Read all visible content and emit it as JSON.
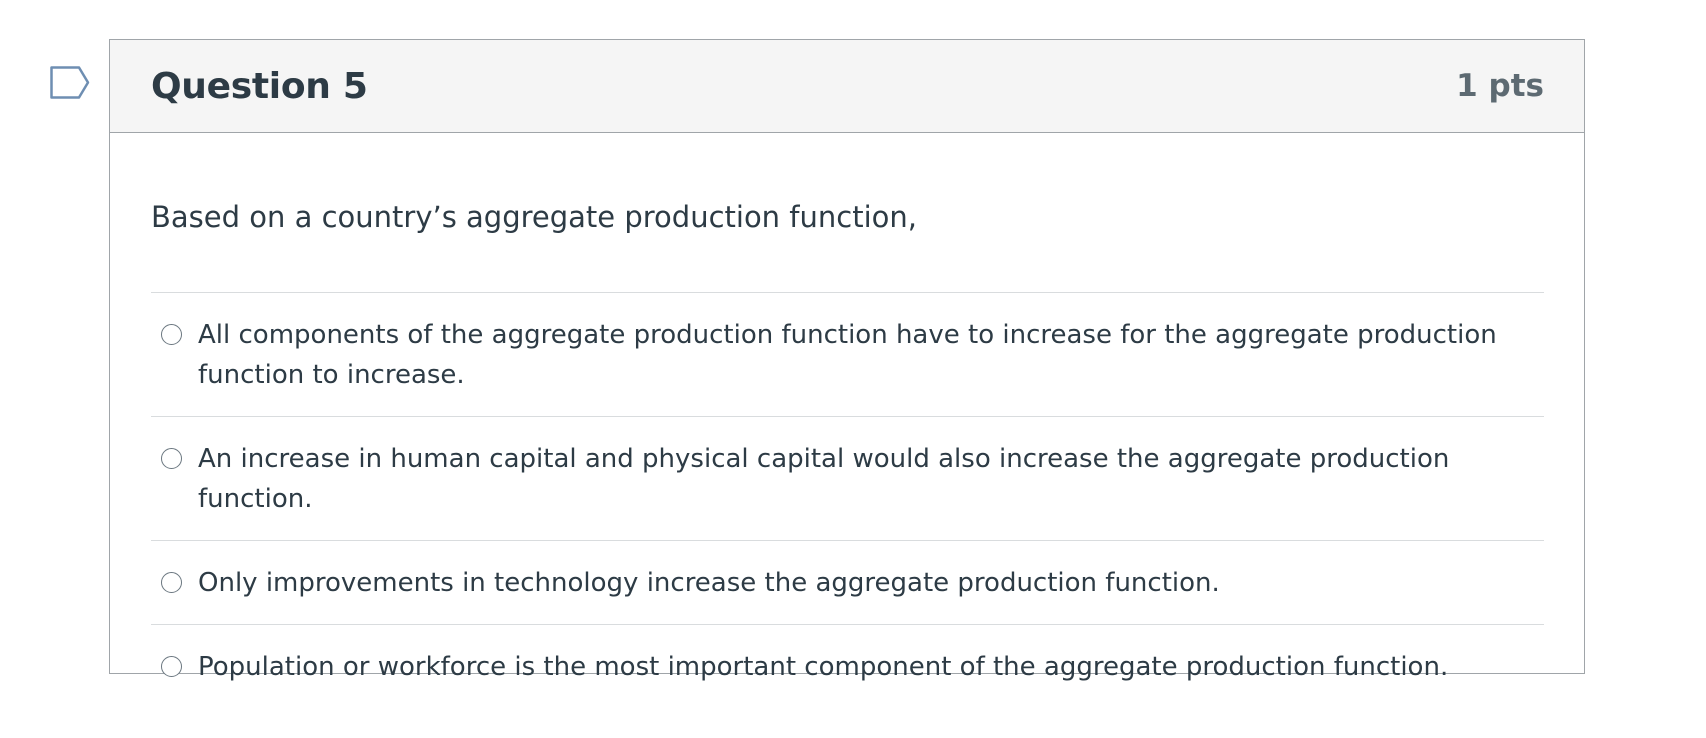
{
  "question": {
    "title": "Question 5",
    "points": "1 pts",
    "text": "Based on a country’s aggregate production function,",
    "answers": [
      {
        "label": "All components of the aggregate production function have to increase for the aggregate production function to increase.",
        "selected": false
      },
      {
        "label": "An increase in human capital and physical capital would also increase the aggregate production function.",
        "selected": false
      },
      {
        "label": "Only improvements in technology increase the aggregate production function.",
        "selected": false
      },
      {
        "label": "Population or workforce is the most important component of the aggregate production function.",
        "selected": false
      }
    ]
  },
  "icons": {
    "flag": "flag-question-icon",
    "radio": "radio-button-icon"
  },
  "colors": {
    "text": "#2d3b45",
    "points": "#5d6a72",
    "header_bg": "#f5f5f5",
    "border": "#a0a5a9",
    "divider": "#d9dcde",
    "flag": "#6e8eb2"
  }
}
